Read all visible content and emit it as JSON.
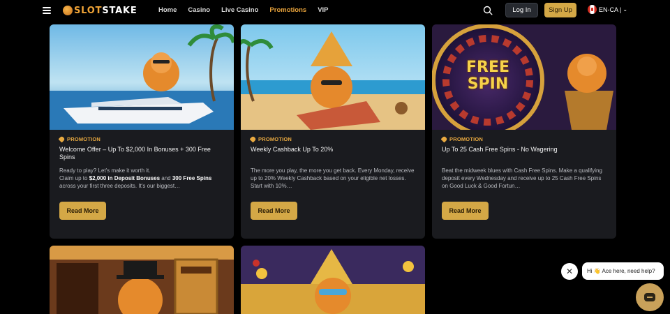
{
  "header": {
    "logo": {
      "part1": "SLOT",
      "part2": "STAKE"
    },
    "nav": [
      {
        "label": "Home",
        "active": false
      },
      {
        "label": "Casino",
        "active": false
      },
      {
        "label": "Live Casino",
        "active": false
      },
      {
        "label": "Promotions",
        "active": true
      },
      {
        "label": "VIP",
        "active": false
      }
    ],
    "login_label": "Log In",
    "signup_label": "Sign Up",
    "locale_label": "EN-CA |"
  },
  "promotions": [
    {
      "tag": "PROMOTION",
      "title": "Welcome Offer – Up To $2,000 In Bonuses + 300 Free Spins",
      "desc_line1": "Ready to play? Let's make it worth it.",
      "desc_pre": "Claim up to ",
      "desc_b1": "$2,000 in Deposit Bonuses",
      "desc_mid": " and ",
      "desc_b2": "300 Free Spins",
      "desc_post": " across your first three deposits. It's our biggest…",
      "button": "Read More"
    },
    {
      "tag": "PROMOTION",
      "title": "Weekly Cashback Up To 20%",
      "desc": "The more you play, the more you get back. Every Monday, receive up to 20% Weekly Cashback based on your eligible net losses. Start with 10%…",
      "button": "Read More"
    },
    {
      "tag": "PROMOTION",
      "title": "Up To 25 Cash Free Spins - No Wagering",
      "image_text": "FREE SPIN",
      "desc": "Beat the midweek blues with Cash Free Spins. Make a qualifying deposit every Wednesday and receive up to 25 Cash Free Spins on Good Luck & Good Fortun…",
      "button": "Read More"
    }
  ],
  "chat": {
    "close_icon": "close-icon",
    "message": "Hi 👋 Ace here, need help?"
  },
  "colors": {
    "accent": "#d4a846",
    "card_bg": "#1a1b1f",
    "promo_tag": "#e8a940"
  }
}
